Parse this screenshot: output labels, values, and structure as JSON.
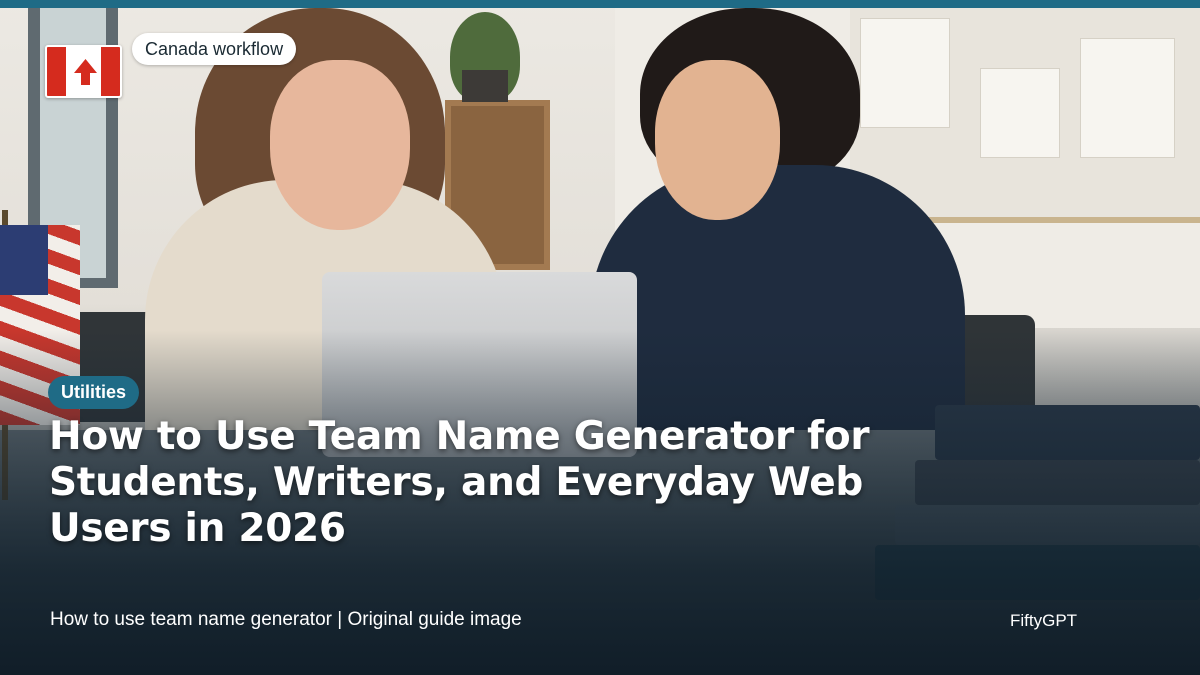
{
  "badge": {
    "label": "Canada workflow"
  },
  "category": {
    "label": "Utilities"
  },
  "headline": {
    "text": "How to Use Team Name Generator for Students, Writers, and Everyday Web Users in 2026"
  },
  "caption": {
    "text": "How to use team name generator | Original guide image"
  },
  "brand": {
    "name": "FiftyGPT"
  },
  "colors": {
    "accent": "#1f6b86",
    "flag_red": "#d52b1e",
    "text": "#ffffff"
  },
  "icons": {
    "flag": "canada-flag-icon"
  }
}
